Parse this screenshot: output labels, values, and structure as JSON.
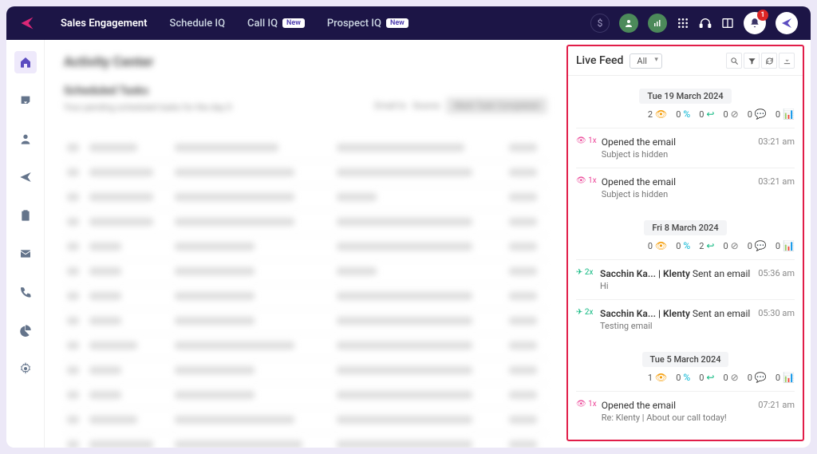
{
  "header": {
    "tabs": [
      {
        "label": "Sales Engagement",
        "active": true
      },
      {
        "label": "Schedule IQ"
      },
      {
        "label": "Call IQ",
        "new": true
      },
      {
        "label": "Prospect IQ",
        "new": true
      }
    ],
    "new_badge": "New",
    "notif_count": "1"
  },
  "blurred": {
    "title": "Activity Center",
    "sub": "Scheduled Tasks",
    "desc": "Your pending scheduled tasks for the day  0",
    "pill_label": "Mark Task Completed",
    "col1": "Email to",
    "col2": "Source"
  },
  "live_feed": {
    "title": "Live Feed",
    "filter": "All",
    "days": [
      {
        "date": "Tue 19 March 2024",
        "stats": {
          "opens": "2",
          "clicks": "0",
          "links": "0",
          "replies": "0",
          "chats": "0",
          "bars": "0"
        },
        "items": [
          {
            "type": "opened",
            "count": "1x",
            "title": "Opened the email",
            "subject": "Subject is hidden",
            "time": "03:21 am"
          },
          {
            "type": "opened",
            "count": "1x",
            "title": "Opened the email",
            "subject": "Subject is hidden",
            "time": "03:21 am"
          }
        ]
      },
      {
        "date": "Fri 8 March 2024",
        "stats": {
          "opens": "0",
          "clicks": "0",
          "links": "2",
          "replies": "0",
          "chats": "0",
          "bars": "0"
        },
        "items": [
          {
            "type": "sent",
            "count": "2x",
            "who": "Sacchin Ka... | Klenty",
            "title": "Sent an email",
            "subject": "Hi",
            "time": "05:36 am"
          },
          {
            "type": "sent",
            "count": "2x",
            "who": "Sacchin Ka... | Klenty",
            "title": "Sent an email",
            "subject": "Testing email",
            "time": "05:30 am"
          }
        ]
      },
      {
        "date": "Tue 5 March 2024",
        "stats": {
          "opens": "1",
          "clicks": "0",
          "links": "0",
          "replies": "0",
          "chats": "0",
          "bars": "0"
        },
        "items": [
          {
            "type": "opened",
            "count": "1x",
            "title": "Opened the email",
            "subject": "Re: Klenty | About our call today!",
            "time": "07:21 am"
          }
        ]
      }
    ]
  }
}
